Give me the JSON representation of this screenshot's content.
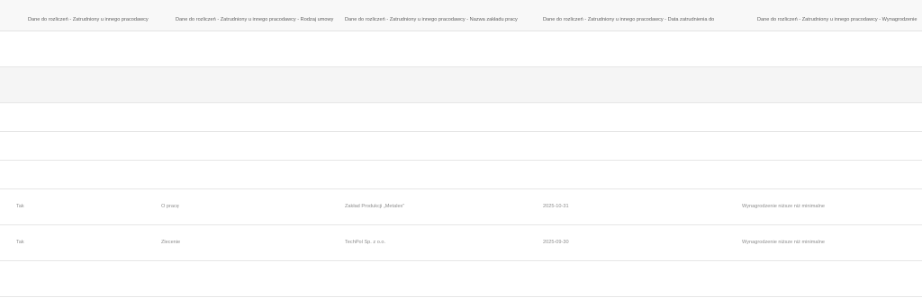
{
  "table": {
    "headers": [
      "Dane do rozliczeń - Zatrudniony u innego pracodawcy",
      "Dane do rozliczeń - Zatrudniony u innego pracodawcy - Rodzaj umowy",
      "Dane do rozliczeń - Zatrudniony u innego pracodawcy - Nazwa zakładu pracy",
      "Dane do rozliczeń - Zatrudniony u innego pracodawcy - Data zatrudnienia do",
      "Dane do rozliczeń - Zatrudniony u innego pracodawcy - Wynagrodzenie"
    ],
    "rows": [
      [
        "",
        "",
        "",
        "",
        ""
      ],
      [
        "",
        "",
        "",
        "",
        ""
      ],
      [
        "",
        "",
        "",
        "",
        ""
      ],
      [
        "",
        "",
        "",
        "",
        ""
      ],
      [
        "",
        "",
        "",
        "",
        ""
      ],
      [
        "Tak",
        "O pracę",
        "Zakład Produkcji „Metalex”",
        "2025-10-31",
        "Wynagrodzenie niższe niż minimalne"
      ],
      [
        "Tak",
        "Zlecenie",
        "TechPol Sp. z o.o.",
        "2025-09-30",
        "Wynagrodzenie niższe niż minimalne"
      ],
      [
        "",
        "",
        "",
        "",
        ""
      ]
    ]
  }
}
